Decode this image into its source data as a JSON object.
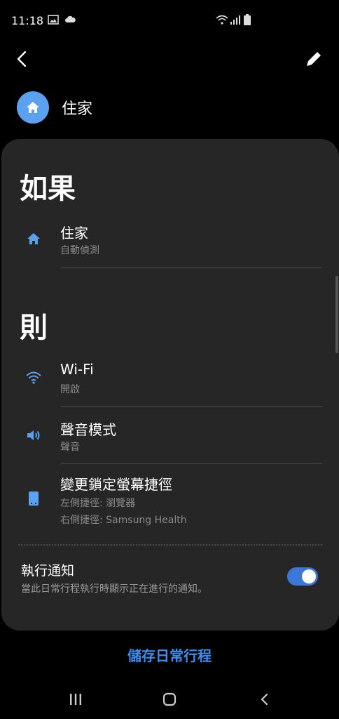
{
  "status": {
    "time": "11:18"
  },
  "routine": {
    "name": "住家"
  },
  "if_section": {
    "title": "如果",
    "item": {
      "title": "住家",
      "subtitle": "自動偵測",
      "icon": "home-icon"
    }
  },
  "then_section": {
    "title": "則",
    "items": [
      {
        "title": "Wi-Fi",
        "subtitle": "開啟",
        "icon": "wifi-icon"
      },
      {
        "title": "聲音模式",
        "subtitle": "聲音",
        "icon": "volume-icon"
      },
      {
        "title": "變更鎖定螢幕捷徑",
        "subtitle": "左側捷徑: 瀏覽器",
        "subtitle2": "右側捷徑: Samsung Health",
        "icon": "phone-icon"
      }
    ]
  },
  "notification": {
    "title": "執行通知",
    "subtitle": "當此日常行程執行時顯示正在進行的通知。",
    "enabled": true
  },
  "save_label": "儲存日常行程",
  "colors": {
    "accent": "#3b8ef0",
    "card_bg": "#262626",
    "toggle_on": "#3c78d8"
  }
}
